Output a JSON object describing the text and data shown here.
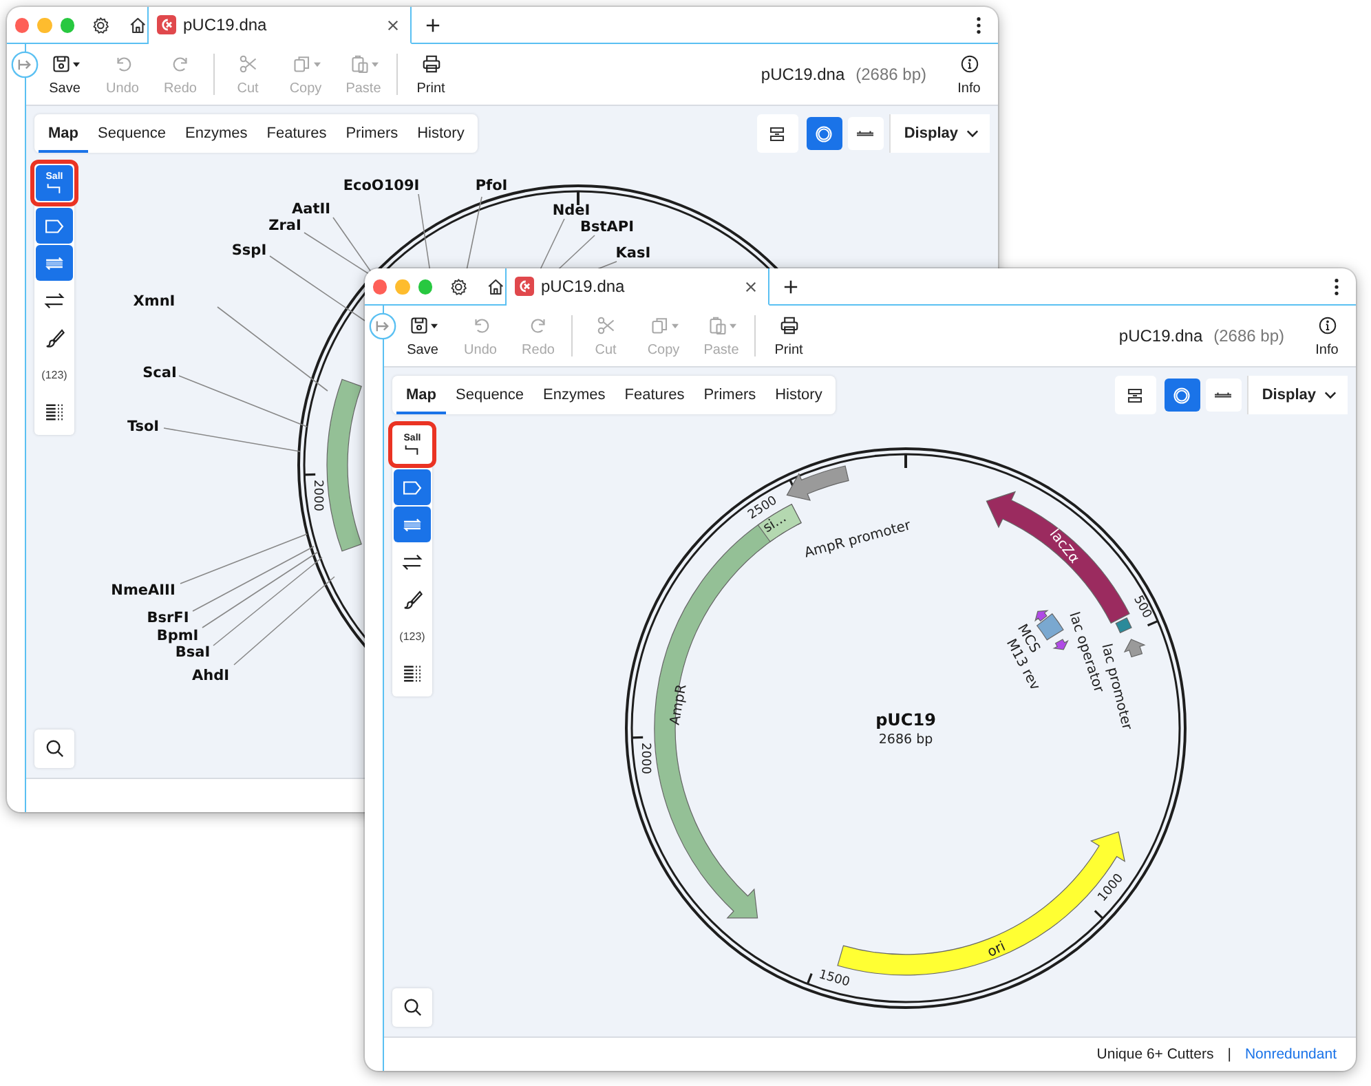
{
  "windows": [
    {
      "tabs": [
        {
          "title": "pUC19.dna",
          "selected": true
        }
      ],
      "toolbar": [
        {
          "label": "Save",
          "kind": "save",
          "menu": true,
          "disabled": false
        },
        {
          "label": "Undo",
          "kind": "undo",
          "menu": false,
          "disabled": true
        },
        {
          "label": "Redo",
          "kind": "redo",
          "menu": false,
          "disabled": true
        },
        {
          "label": "Cut",
          "kind": "cut",
          "menu": false,
          "disabled": true
        },
        {
          "label": "Copy",
          "kind": "copy",
          "menu": true,
          "disabled": true
        },
        {
          "label": "Paste",
          "kind": "paste",
          "menu": true,
          "disabled": true
        },
        {
          "label": "Print",
          "kind": "print",
          "menu": false,
          "disabled": false
        }
      ],
      "file_name": "pUC19.dna",
      "length": "(2686 bp)",
      "info": "Info",
      "view_tabs": [
        {
          "label": "Map",
          "selected": true
        },
        {
          "label": "Sequence",
          "selected": false
        },
        {
          "label": "Enzymes",
          "selected": false
        },
        {
          "label": "Features",
          "selected": false
        },
        {
          "label": "Primers",
          "selected": false
        },
        {
          "label": "History",
          "selected": false
        }
      ],
      "view_modes": [
        {
          "kind": "sequence",
          "selected": false
        },
        {
          "kind": "circular",
          "selected": true
        },
        {
          "kind": "linear",
          "selected": false
        }
      ],
      "display": "Display",
      "tools": [
        {
          "kind": "enzymes",
          "label": "SalI",
          "selected": true,
          "highlighted": true
        },
        {
          "kind": "features",
          "selected": true,
          "highlighted": false
        },
        {
          "kind": "primers",
          "selected": true,
          "highlighted": false
        },
        {
          "kind": "orfs",
          "selected": false,
          "highlighted": false
        },
        {
          "kind": "colors",
          "selected": false,
          "highlighted": false
        },
        {
          "kind": "numbers",
          "label": "(123)",
          "selected": false,
          "highlighted": false
        },
        {
          "kind": "translation",
          "selected": false,
          "highlighted": false
        }
      ],
      "map": {
        "features": [
          {
            "color": "#94c096"
          }
        ],
        "ticks": [
          {
            "label": "2000"
          }
        ],
        "enzymes": [
          "EcoO109I",
          "PfoI",
          "AatII",
          "NdeI",
          "ZraI",
          "BstAPI",
          "SspI",
          "KasI",
          "XmnI",
          "ScaI",
          "TsoI",
          "NmeAIII",
          "BsrFI",
          "BpmI",
          "BsaI",
          "AhdI"
        ]
      }
    },
    {
      "tabs": [
        {
          "title": "pUC19.dna",
          "selected": true
        }
      ],
      "toolbar": [
        {
          "label": "Save",
          "kind": "save",
          "menu": true,
          "disabled": false
        },
        {
          "label": "Undo",
          "kind": "undo",
          "menu": false,
          "disabled": true
        },
        {
          "label": "Redo",
          "kind": "redo",
          "menu": false,
          "disabled": true
        },
        {
          "label": "Cut",
          "kind": "cut",
          "menu": false,
          "disabled": true
        },
        {
          "label": "Copy",
          "kind": "copy",
          "menu": true,
          "disabled": true
        },
        {
          "label": "Paste",
          "kind": "paste",
          "menu": true,
          "disabled": true
        },
        {
          "label": "Print",
          "kind": "print",
          "menu": false,
          "disabled": false
        }
      ],
      "file_name": "pUC19.dna",
      "length": "(2686 bp)",
      "info": "Info",
      "view_tabs": [
        {
          "label": "Map",
          "selected": true
        },
        {
          "label": "Sequence",
          "selected": false
        },
        {
          "label": "Enzymes",
          "selected": false
        },
        {
          "label": "Features",
          "selected": false
        },
        {
          "label": "Primers",
          "selected": false
        },
        {
          "label": "History",
          "selected": false
        }
      ],
      "view_modes": [
        {
          "kind": "sequence",
          "selected": false
        },
        {
          "kind": "circular",
          "selected": true
        },
        {
          "kind": "linear",
          "selected": false
        }
      ],
      "display": "Display",
      "tools": [
        {
          "kind": "enzymes",
          "label": "SalI",
          "selected": false,
          "highlighted": true
        },
        {
          "kind": "features",
          "selected": true,
          "highlighted": false
        },
        {
          "kind": "primers",
          "selected": true,
          "highlighted": false
        },
        {
          "kind": "orfs",
          "selected": false,
          "highlighted": false
        },
        {
          "kind": "colors",
          "selected": false,
          "highlighted": false
        },
        {
          "kind": "numbers",
          "label": "(123)",
          "selected": false,
          "highlighted": false
        },
        {
          "kind": "translation",
          "selected": false,
          "highlighted": false
        }
      ],
      "map": {
        "title": "pUC19",
        "subtitle": "2686 bp",
        "features": [
          {
            "label": "AmpR",
            "color": "#94c096"
          },
          {
            "label": "si...",
            "color": "#b4d8b0"
          },
          {
            "label": "AmpR promoter",
            "color": "#9a9a9a"
          },
          {
            "label": "lacZα",
            "color": "#9b2b5f"
          },
          {
            "label": "lac operator",
            "color": "#2b8a9a"
          },
          {
            "label": "lac promoter",
            "color": "#9a9a9a"
          },
          {
            "label": "MCS",
            "color": "#7aa8d0"
          },
          {
            "label": "M13 rev",
            "color": "#b04ae6"
          },
          {
            "label": "ori",
            "color": "#ffff33"
          },
          {
            "color": "#b04ae6"
          }
        ],
        "ticks": [
          {
            "label": "2000"
          },
          {
            "label": "2500"
          },
          {
            "label": "500"
          },
          {
            "label": "1000"
          },
          {
            "label": "1500"
          }
        ]
      },
      "status": [
        {
          "text": "Unique 6+ Cutters",
          "kind": "label"
        },
        {
          "text": "|",
          "kind": "separator"
        },
        {
          "text": "Nonredundant",
          "kind": "link"
        }
      ]
    }
  ]
}
